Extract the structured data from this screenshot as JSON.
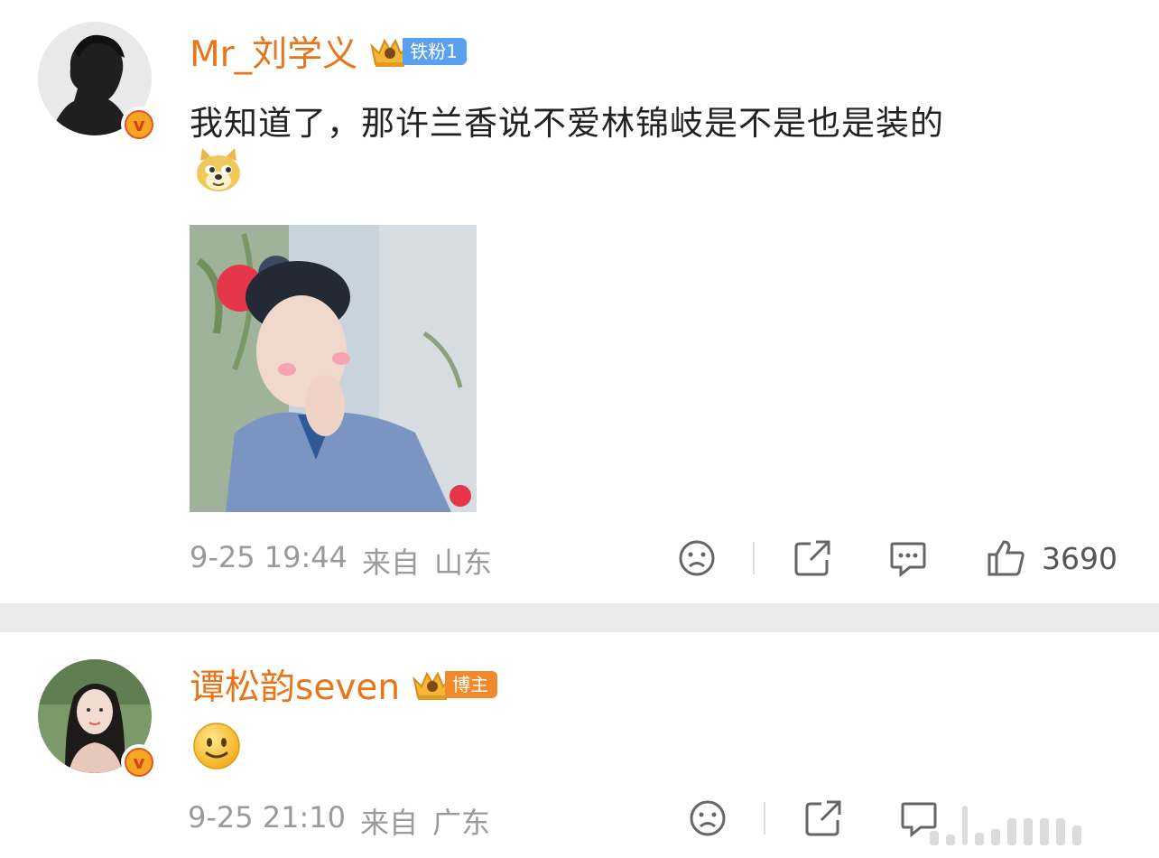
{
  "comments": [
    {
      "username": "Mr_刘学义",
      "badge": "铁粉1",
      "text": "我知道了，那许兰香说不爱林锦岐是不是也是装的",
      "emoji": "doge-emoji",
      "time": "9-25 19:44",
      "source_label": "来自",
      "location": "山东",
      "likes": "3690"
    },
    {
      "username": "谭松韵seven",
      "badge": "博主",
      "emoji": "smile-emoji",
      "time": "9-25 21:10",
      "source_label": "来自",
      "location": "广东"
    }
  ],
  "colors": {
    "username": "#e8751a",
    "fan_badge": "#5aa0ee",
    "blogger_badge": "#f08a2a",
    "meta": "#9a9a9a",
    "divider": "#ececec"
  },
  "icons": [
    "sad-face-icon",
    "share-icon",
    "comment-icon",
    "like-icon",
    "verified-icon",
    "crown-icon"
  ]
}
